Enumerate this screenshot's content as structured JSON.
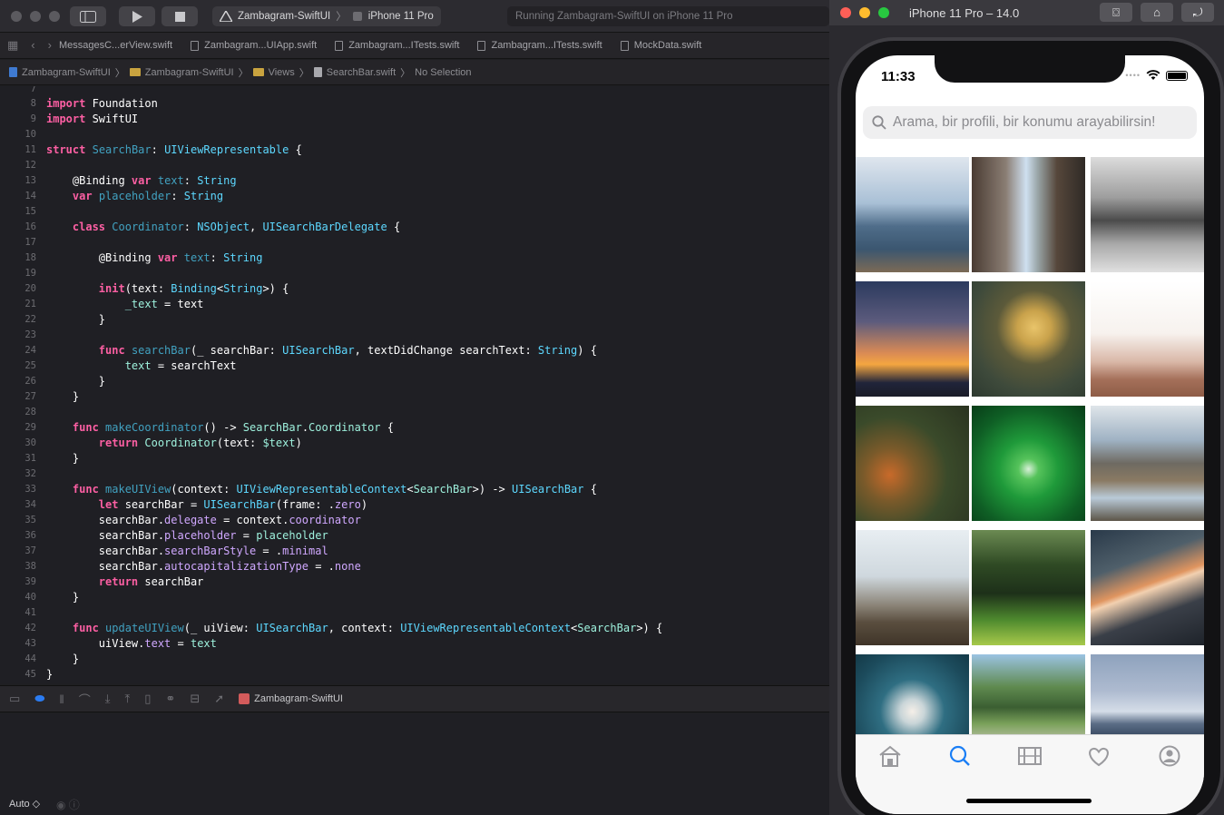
{
  "xcode": {
    "toolbar": {
      "scheme_project": "Zambagram-SwiftUI",
      "scheme_device": "iPhone 11 Pro",
      "status_text": "Running Zambagram-SwiftUI on iPhone 11 Pro"
    },
    "tabs": [
      "MessagesC...erView.swift",
      "Zambagram...UIApp.swift",
      "Zambagram...ITests.swift",
      "Zambagram...ITests.swift",
      "MockData.swift"
    ],
    "jumpbar": {
      "project": "Zambagram-SwiftUI",
      "group": "Zambagram-SwiftUI",
      "folder": "Views",
      "file": "SearchBar.swift",
      "selection": "No Selection"
    },
    "editor": {
      "first_line_number": "7",
      "line_numbers": [
        "8",
        "9",
        "10",
        "11",
        "12",
        "13",
        "14",
        "15",
        "16",
        "17",
        "18",
        "19",
        "20",
        "21",
        "22",
        "23",
        "24",
        "25",
        "26",
        "27",
        "28",
        "29",
        "30",
        "31",
        "32",
        "33",
        "34",
        "35",
        "36",
        "37",
        "38",
        "39",
        "40",
        "41",
        "42",
        "43",
        "44",
        "45"
      ]
    },
    "debugbar": {
      "target": "Zambagram-SwiftUI"
    },
    "console": {
      "scope_selector": "Auto ◇"
    }
  },
  "simulator": {
    "title": "iPhone 11 Pro – 14.0",
    "status_time": "11:33",
    "search_placeholder": "Arama, bir profili, bir konumu arayabilirsin!",
    "tab_items": [
      {
        "icon": "home-icon"
      },
      {
        "icon": "search-icon"
      },
      {
        "icon": "film-icon"
      },
      {
        "icon": "heart-icon"
      },
      {
        "icon": "person-icon"
      }
    ],
    "colors": {
      "active_tab": "#1a7ef5",
      "inactive_tab": "#9a9a9e"
    }
  }
}
